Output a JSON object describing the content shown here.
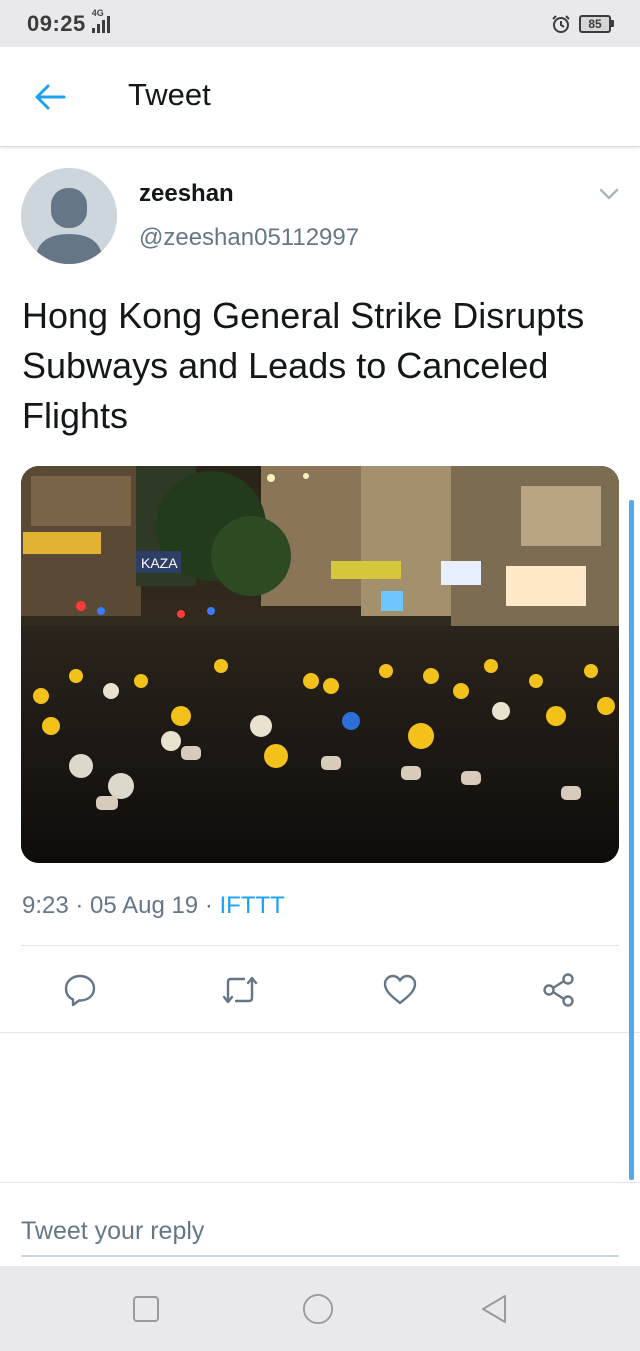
{
  "status_bar": {
    "time": "09:25",
    "network": "4G",
    "battery": "85"
  },
  "header": {
    "back_icon": "arrow-left-icon",
    "title": "Tweet"
  },
  "tweet": {
    "user_name": "zeeshan",
    "user_handle": "@zeeshan05112997",
    "text": "Hong Kong General Strike Disrupts Subways and Leads to Canceled Flights",
    "image_sign_text": "KAZA",
    "meta": {
      "time": "9:23",
      "separator": " · ",
      "date": "05 Aug 19",
      "source": "IFTTT"
    },
    "actions": [
      "reply-icon",
      "retweet-icon",
      "like-icon",
      "share-icon"
    ]
  },
  "reply": {
    "placeholder": "Tweet your reply"
  },
  "nav": [
    "recents-square-icon",
    "home-circle-icon",
    "back-triangle-icon"
  ],
  "colors": {
    "accent": "#1da1f2",
    "text": "#14171a",
    "secondary": "#657786",
    "status_bg": "#e9e9eb"
  }
}
